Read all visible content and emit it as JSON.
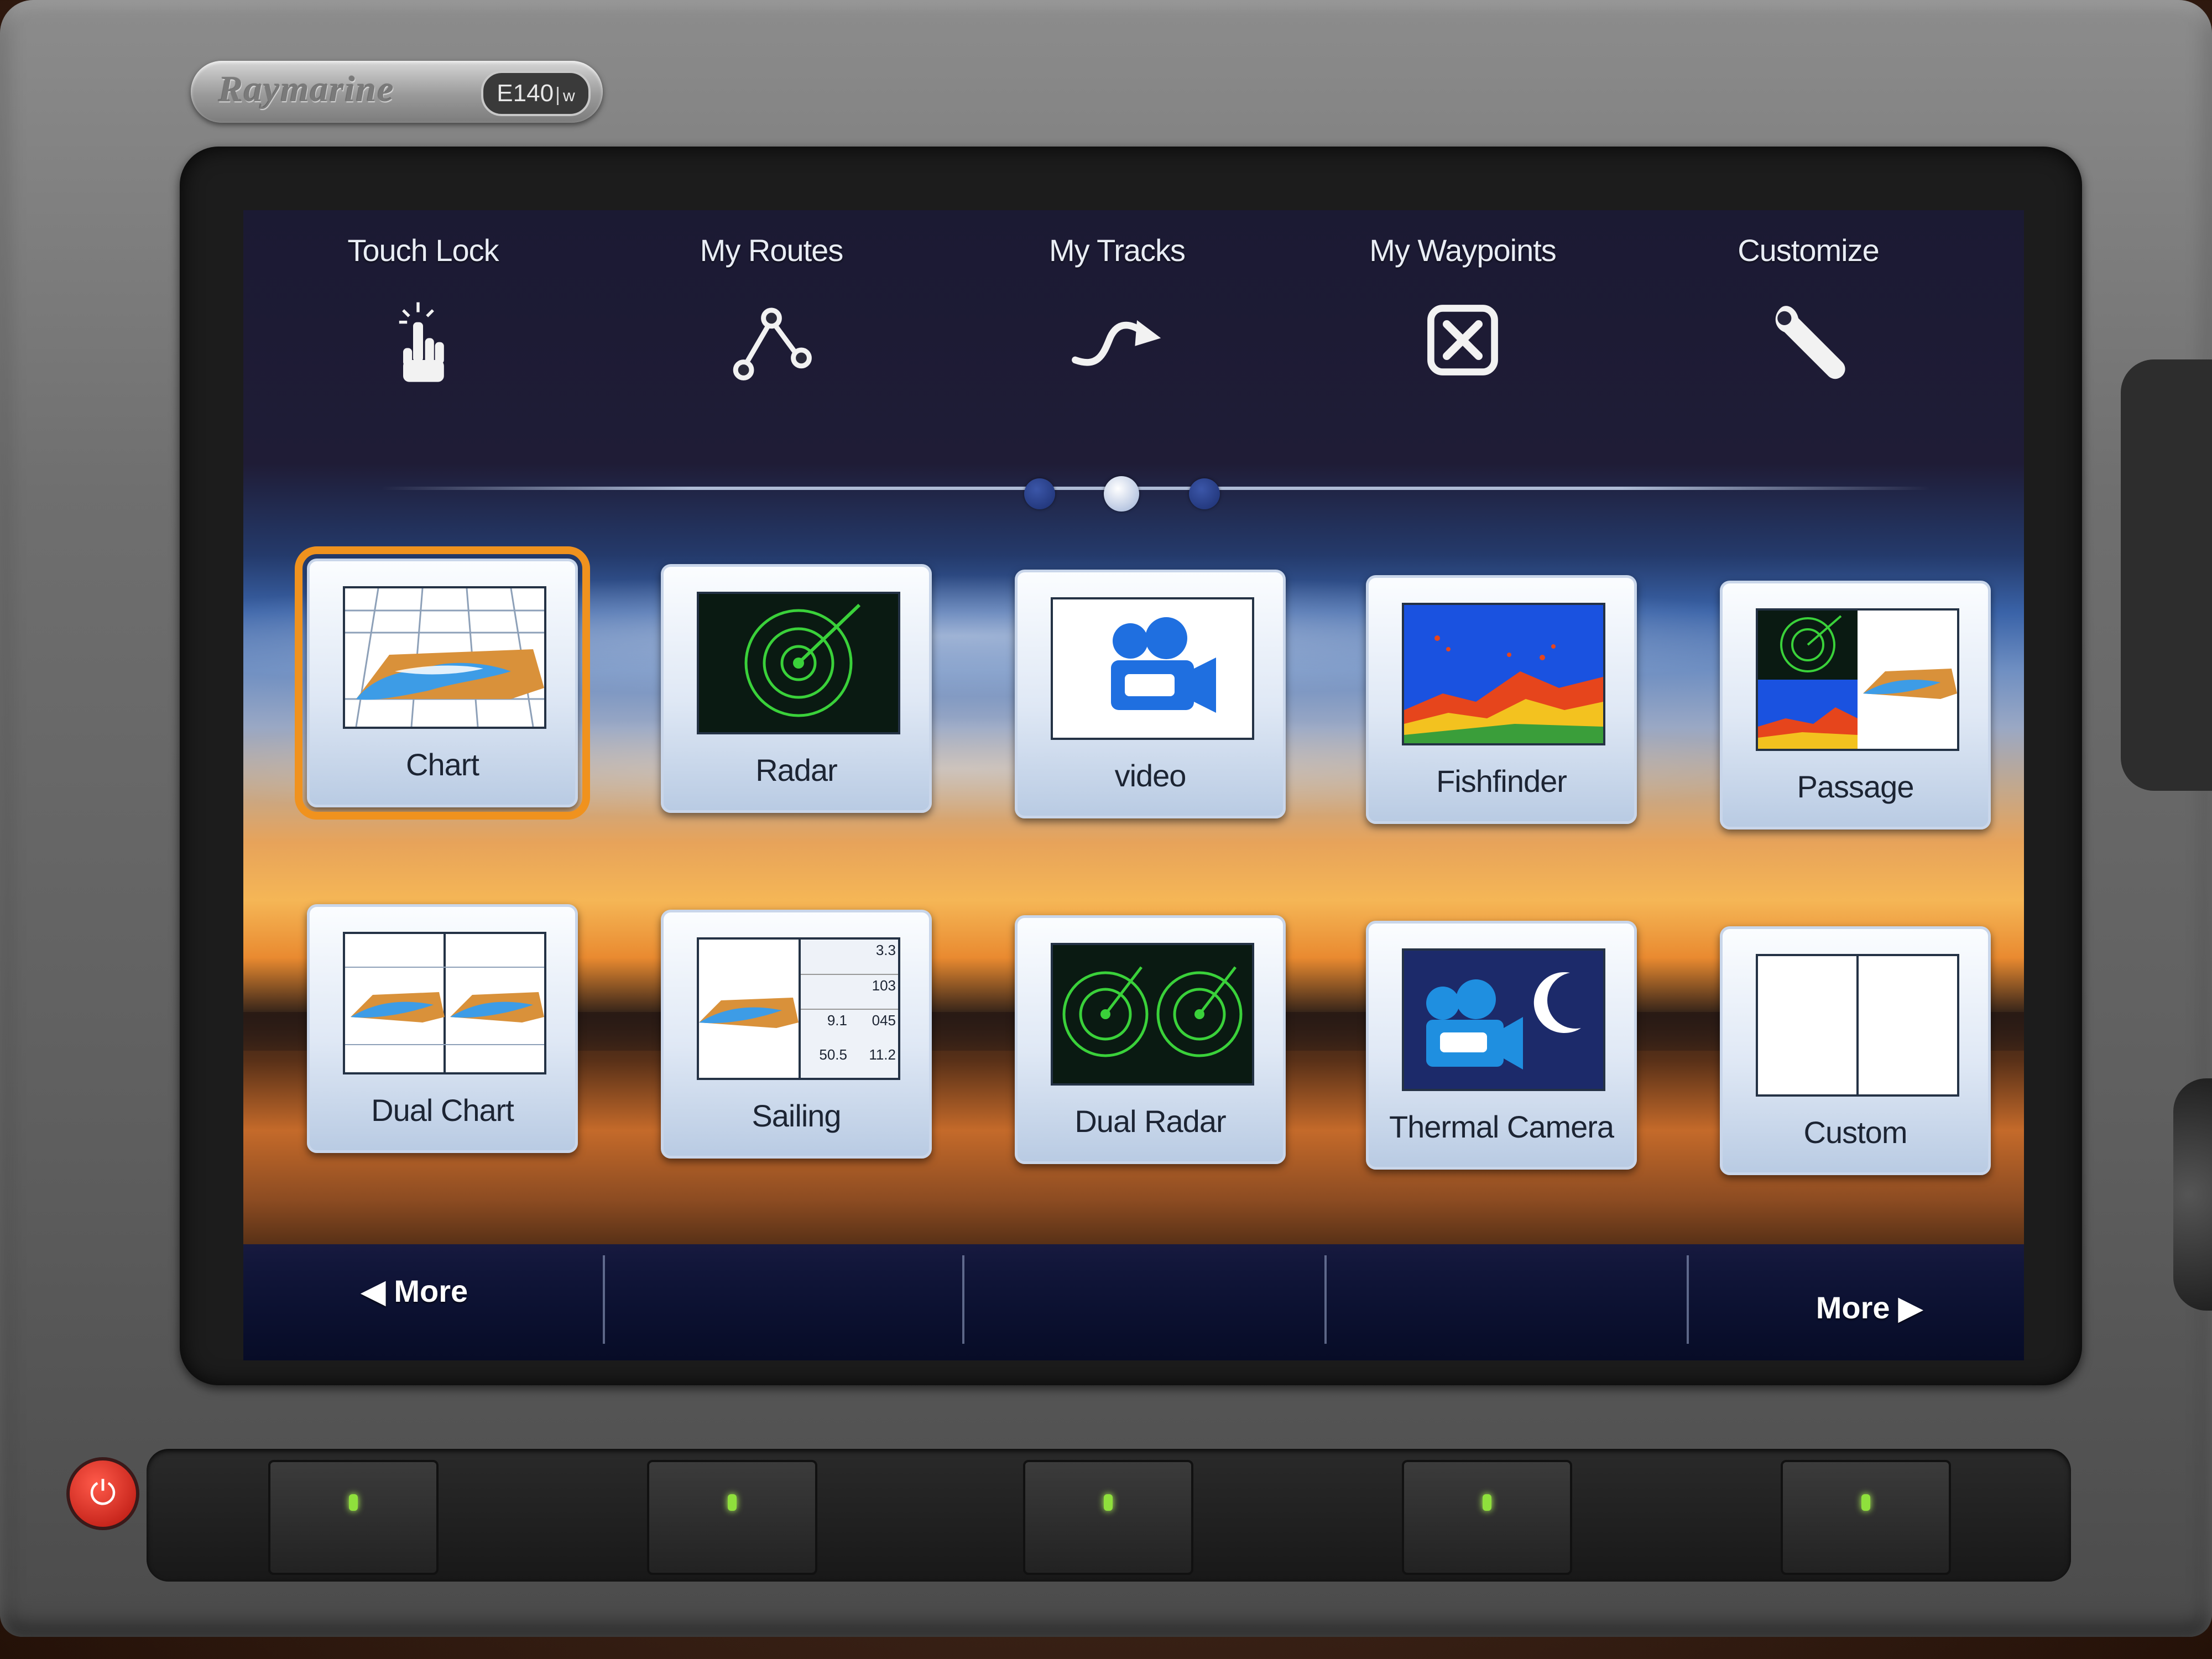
{
  "device": {
    "brand": "Raymarine",
    "model": "E140",
    "model_suffix": "w"
  },
  "top_menu": [
    {
      "label": "Touch Lock",
      "icon": "touch-hand-icon"
    },
    {
      "label": "My Routes",
      "icon": "route-nodes-icon"
    },
    {
      "label": "My Tracks",
      "icon": "track-arrow-icon"
    },
    {
      "label": "My Waypoints",
      "icon": "waypoint-x-icon"
    },
    {
      "label": "Customize",
      "icon": "wrench-icon"
    }
  ],
  "pagination": {
    "pages": 3,
    "current": 2
  },
  "apps_row1": [
    {
      "label": "Chart"
    },
    {
      "label": "Radar"
    },
    {
      "label": "video"
    },
    {
      "label": "Fishfinder"
    },
    {
      "label": "Passage"
    }
  ],
  "apps_row2": [
    {
      "label": "Dual Chart"
    },
    {
      "label": "Sailing"
    },
    {
      "label": "Dual Radar"
    },
    {
      "label": "Thermal Camera"
    },
    {
      "label": "Custom"
    }
  ],
  "selected_app": "Chart",
  "sailing_thumb": {
    "values": [
      "3.3",
      "103",
      "9.1",
      "045",
      "50.5",
      "11.2"
    ]
  },
  "softkeys": {
    "left": "◀ More",
    "right": "More ▶"
  },
  "colors": {
    "selection": "#f0921e",
    "radar_green": "#3ad13a",
    "led_green": "#8fe03c"
  }
}
